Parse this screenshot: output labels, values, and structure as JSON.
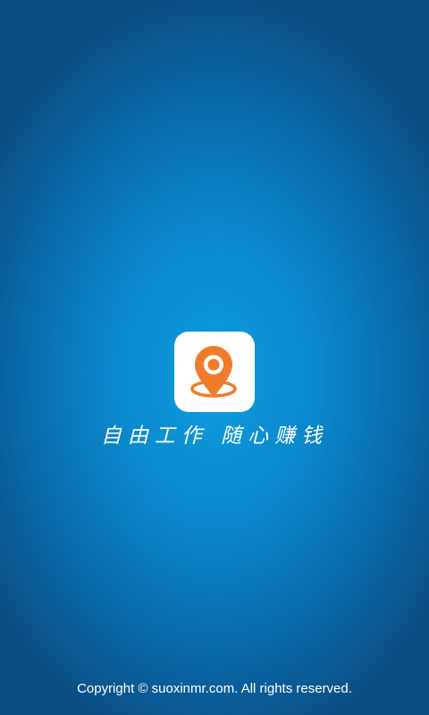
{
  "splash": {
    "logo_icon": "location-pin-icon",
    "brand_color": "#f07c2b",
    "slogan": "自由工作 随心赚钱",
    "copyright": "Copyright © suoxinmr.com. All rights reserved."
  }
}
